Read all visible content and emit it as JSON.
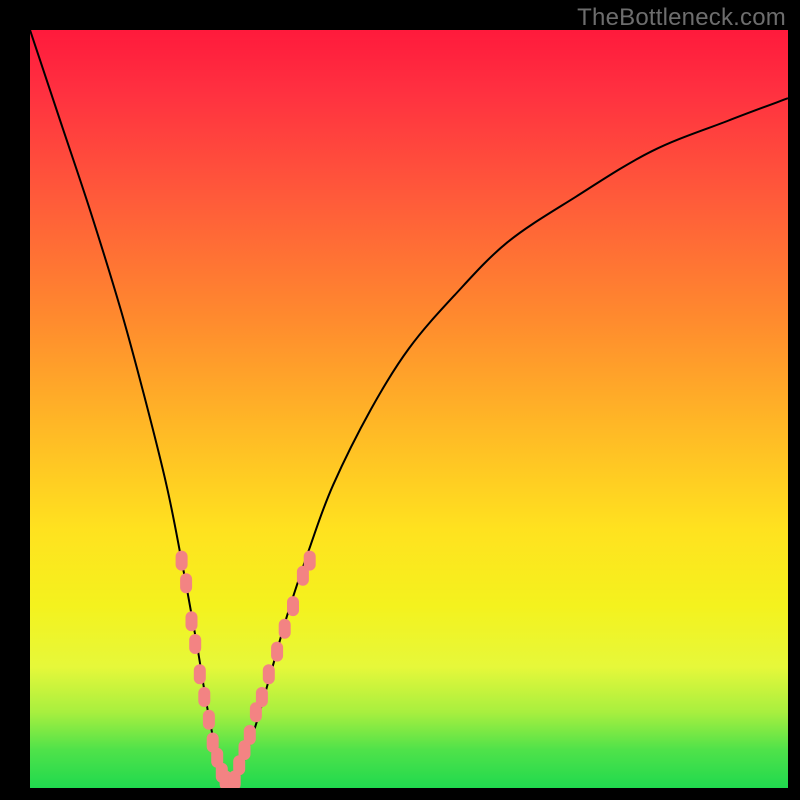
{
  "watermark": "TheBottleneck.com",
  "chart_data": {
    "type": "line",
    "title": "",
    "xlabel": "",
    "ylabel": "",
    "xlim": [
      0,
      100
    ],
    "ylim": [
      0,
      100
    ],
    "series": [
      {
        "name": "bottleneck-curve",
        "x": [
          0,
          4,
          8,
          12,
          15,
          18,
          20,
          22,
          23.5,
          25,
          26.5,
          28,
          30,
          32,
          34,
          37,
          40,
          45,
          50,
          56,
          63,
          72,
          82,
          92,
          100
        ],
        "values": [
          100,
          88,
          76,
          63,
          52,
          40,
          30,
          19,
          10,
          3,
          0,
          3,
          9,
          16,
          23,
          32,
          40,
          50,
          58,
          65,
          72,
          78,
          84,
          88,
          91
        ]
      }
    ],
    "markers": {
      "name": "highlight-points",
      "color": "#f38383",
      "points": [
        {
          "x": 20.0,
          "y": 30
        },
        {
          "x": 20.6,
          "y": 27
        },
        {
          "x": 21.3,
          "y": 22
        },
        {
          "x": 21.8,
          "y": 19
        },
        {
          "x": 22.4,
          "y": 15
        },
        {
          "x": 23.0,
          "y": 12
        },
        {
          "x": 23.6,
          "y": 9
        },
        {
          "x": 24.1,
          "y": 6
        },
        {
          "x": 24.7,
          "y": 4
        },
        {
          "x": 25.3,
          "y": 2
        },
        {
          "x": 25.8,
          "y": 1
        },
        {
          "x": 26.5,
          "y": 0.5
        },
        {
          "x": 27.0,
          "y": 1
        },
        {
          "x": 27.6,
          "y": 3
        },
        {
          "x": 28.3,
          "y": 5
        },
        {
          "x": 29.0,
          "y": 7
        },
        {
          "x": 29.8,
          "y": 10
        },
        {
          "x": 30.6,
          "y": 12
        },
        {
          "x": 31.5,
          "y": 15
        },
        {
          "x": 32.6,
          "y": 18
        },
        {
          "x": 33.6,
          "y": 21
        },
        {
          "x": 34.7,
          "y": 24
        },
        {
          "x": 36.0,
          "y": 28
        },
        {
          "x": 36.9,
          "y": 30
        }
      ]
    },
    "gradient_stops": [
      {
        "pos": 0,
        "color": "#ff1a3c"
      },
      {
        "pos": 8,
        "color": "#ff3040"
      },
      {
        "pos": 22,
        "color": "#ff5a3a"
      },
      {
        "pos": 38,
        "color": "#ff8a2e"
      },
      {
        "pos": 52,
        "color": "#ffb726"
      },
      {
        "pos": 66,
        "color": "#ffe21f"
      },
      {
        "pos": 76,
        "color": "#f4f21e"
      },
      {
        "pos": 84,
        "color": "#e6f83a"
      },
      {
        "pos": 90,
        "color": "#a8ef3f"
      },
      {
        "pos": 95,
        "color": "#4fe24a"
      },
      {
        "pos": 100,
        "color": "#20d94e"
      }
    ]
  }
}
